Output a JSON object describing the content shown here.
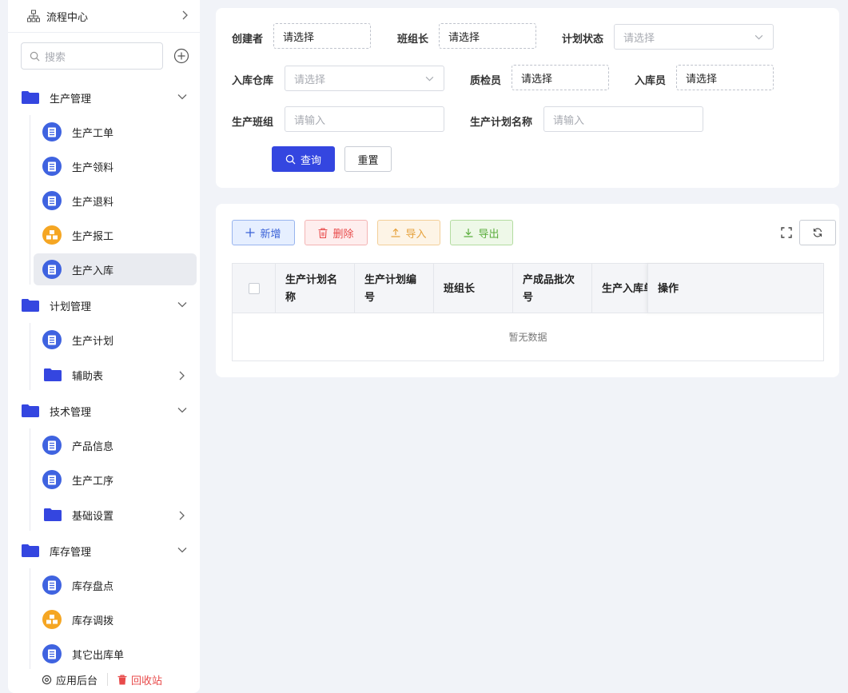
{
  "sidebar": {
    "flow_center": "流程中心",
    "search_placeholder": "搜索",
    "groups": [
      {
        "label": "生产管理",
        "items": [
          {
            "label": "生产工单",
            "icon": "list-icon"
          },
          {
            "label": "生产领料",
            "icon": "list-icon"
          },
          {
            "label": "生产退料",
            "icon": "list-icon"
          },
          {
            "label": "生产报工",
            "icon": "boxes-icon"
          },
          {
            "label": "生产入库",
            "icon": "list-icon",
            "active": true
          }
        ]
      },
      {
        "label": "计划管理",
        "items": [
          {
            "label": "生产计划",
            "icon": "list-icon"
          },
          {
            "label": "辅助表",
            "icon": "folder-icon"
          }
        ]
      },
      {
        "label": "技术管理",
        "items": [
          {
            "label": "产品信息",
            "icon": "list-icon"
          },
          {
            "label": "生产工序",
            "icon": "list-icon"
          },
          {
            "label": "基础设置",
            "icon": "folder-icon"
          }
        ]
      },
      {
        "label": "库存管理",
        "items": [
          {
            "label": "库存盘点",
            "icon": "list-icon"
          },
          {
            "label": "库存调拨",
            "icon": "boxes-icon"
          },
          {
            "label": "其它出库单",
            "icon": "list-icon"
          }
        ]
      }
    ],
    "footer": {
      "app_backend": "应用后台",
      "recycle_bin": "回收站"
    }
  },
  "filter": {
    "creator": {
      "label": "创建者",
      "value": "请选择"
    },
    "team_leader": {
      "label": "班组长",
      "value": "请选择"
    },
    "plan_status": {
      "label": "计划状态",
      "placeholder": "请选择"
    },
    "warehouse": {
      "label": "入库仓库",
      "placeholder": "请选择"
    },
    "inspector": {
      "label": "质检员",
      "value": "请选择"
    },
    "receiver": {
      "label": "入库员",
      "value": "请选择"
    },
    "team": {
      "label": "生产班组",
      "placeholder": "请输入"
    },
    "plan_name": {
      "label": "生产计划名称",
      "placeholder": "请输入"
    },
    "query_label": "查询",
    "reset_label": "重置"
  },
  "toolbar": {
    "add_label": "新增",
    "delete_label": "删除",
    "import_label": "导入",
    "export_label": "导出"
  },
  "table": {
    "columns": [
      "生产计划名称",
      "生产计划编号",
      "班组长",
      "产成品批次号",
      "生产入库单",
      "操作"
    ],
    "empty_text": "暂无数据"
  },
  "colors": {
    "primary": "#3446e0",
    "danger": "#e84a4a",
    "warning": "#e6a23c",
    "success": "#5aad3c"
  }
}
